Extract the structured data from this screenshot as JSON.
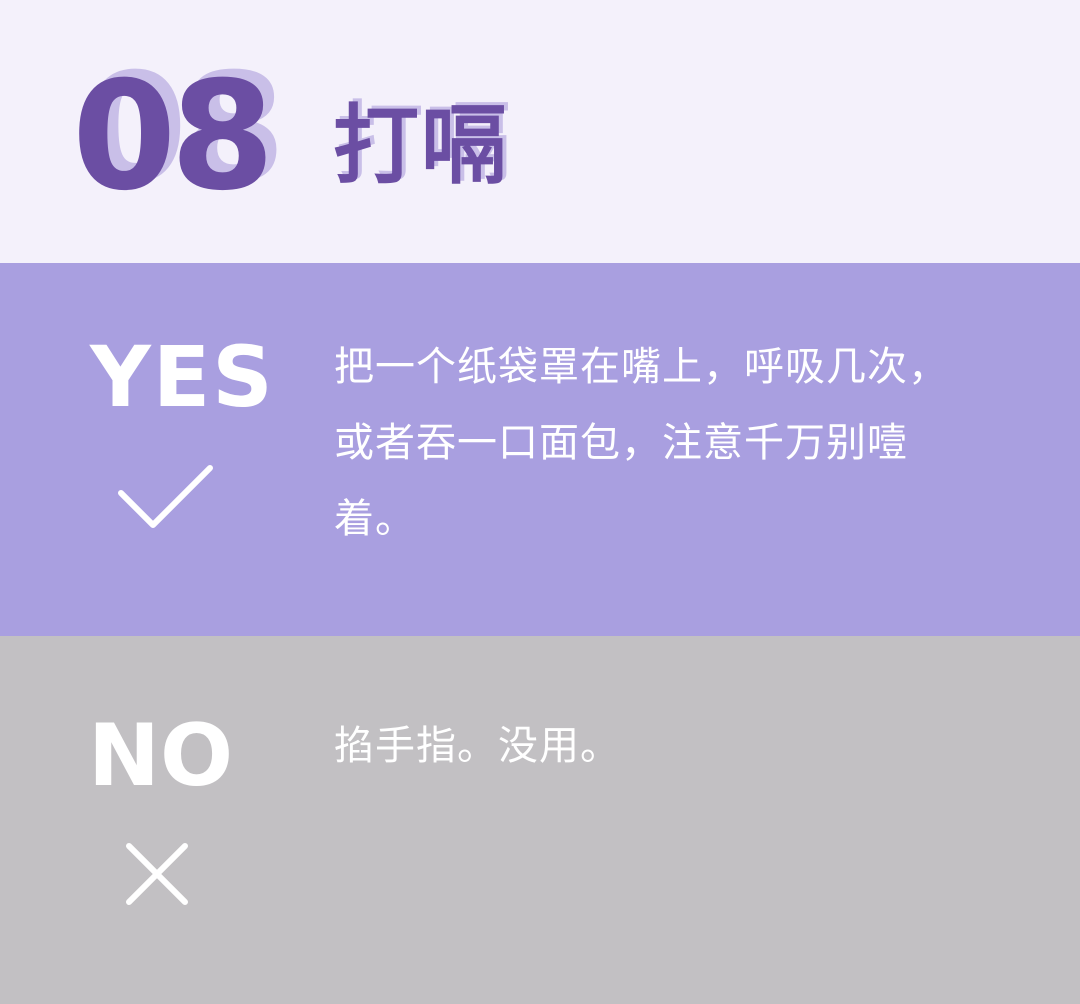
{
  "header": {
    "number": "08",
    "title": "打嗝"
  },
  "yes": {
    "label": "YES",
    "icon": "check-icon",
    "lines": [
      "把一个纸袋罩在嘴上，呼吸几次，",
      "或者吞一口面包，注意千万别噎",
      "着。"
    ]
  },
  "no": {
    "label": "NO",
    "icon": "cross-icon",
    "text": "掐手指。没用。"
  },
  "colors": {
    "header_bg": "#f4f1fb",
    "accent_purple": "#6b4ea3",
    "accent_shadow": "#c9bfe8",
    "yes_bg": "#a99fe0",
    "no_bg": "#c2c0c3",
    "text": "#ffffff"
  }
}
